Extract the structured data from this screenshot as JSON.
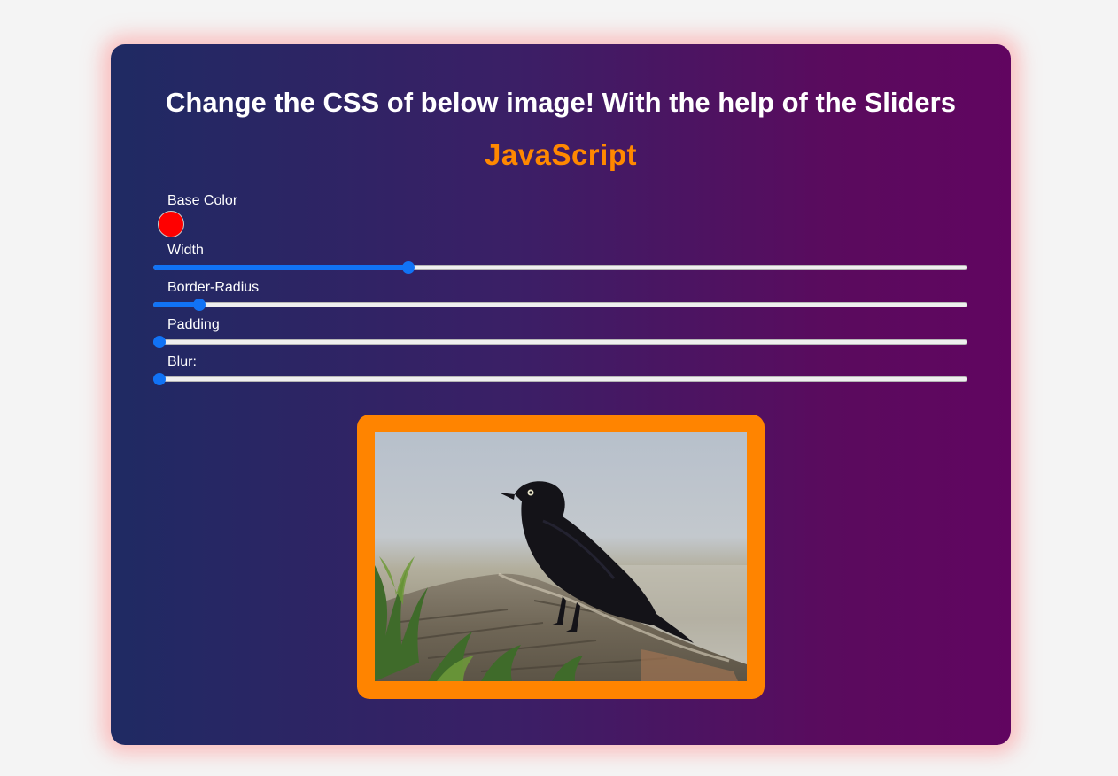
{
  "header": {
    "title": "Change the CSS of below image! With the help of the Sliders",
    "subtitle": "JavaScript"
  },
  "controls": {
    "base_color": {
      "label": "Base Color",
      "value": "#ff0000"
    },
    "width": {
      "label": "Width",
      "fraction": 0.31
    },
    "border_radius": {
      "label": "Border-Radius",
      "fraction": 0.05
    },
    "padding": {
      "label": "Padding",
      "fraction": 0.0
    },
    "blur": {
      "label": "Blur:",
      "fraction": 0.0
    }
  },
  "image": {
    "frame_color": "#ff8400",
    "subject": "blackbird-on-log"
  },
  "colors": {
    "accent": "#1173f5",
    "subtitle": "#ff8800"
  }
}
